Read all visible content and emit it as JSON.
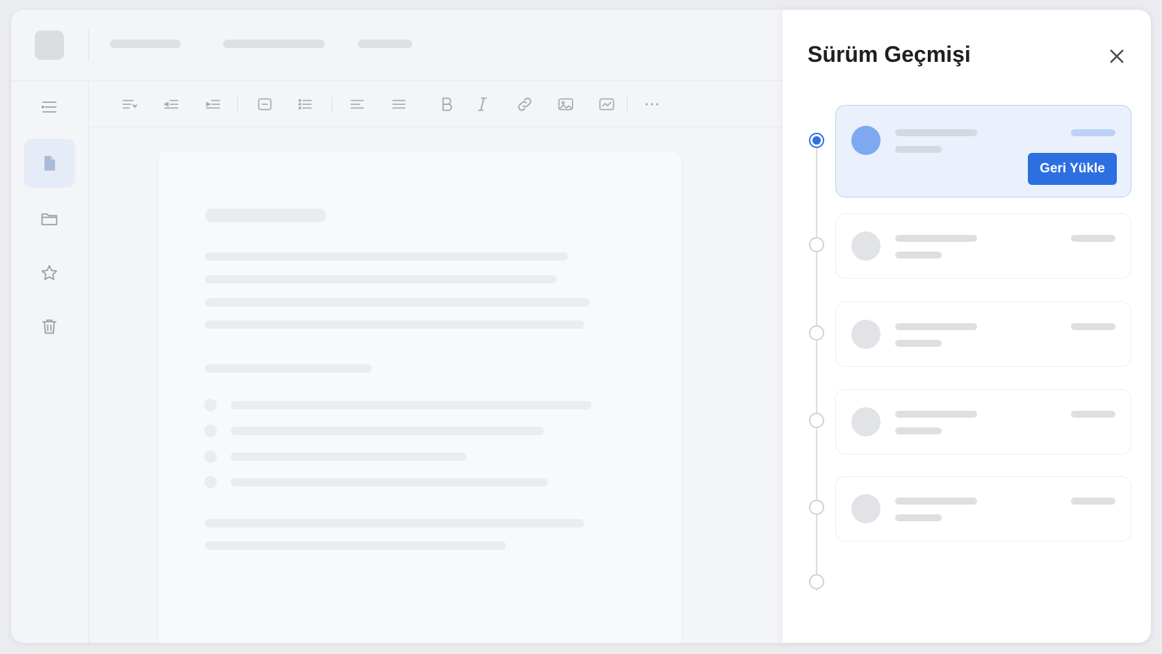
{
  "panel": {
    "title": "Sürüm Geçmişi",
    "close_icon": "close-icon",
    "restore_label": "Geri Yükle"
  },
  "colors": {
    "accent": "#2c6fe0",
    "selected_card_bg": "#eaf1fc",
    "selected_card_border": "#b9cff2"
  },
  "rail": {
    "items": [
      {
        "icon": "menu-icon",
        "active": false
      },
      {
        "icon": "document-icon",
        "active": true
      },
      {
        "icon": "folder-icon",
        "active": false
      },
      {
        "icon": "star-icon",
        "active": false
      },
      {
        "icon": "trash-icon",
        "active": false
      }
    ]
  },
  "toolbar": {
    "icons": [
      "align-left-dropdown-icon",
      "indent-decrease-icon",
      "indent-increase-icon",
      "text-box-icon",
      "bulleted-list-icon",
      "align-left-icon",
      "align-justify-icon",
      "bold-icon",
      "italic-icon",
      "link-icon",
      "image-icon",
      "image-edit-icon",
      "more-icon"
    ]
  },
  "versions": [
    {
      "selected": true
    },
    {
      "selected": false
    },
    {
      "selected": false
    },
    {
      "selected": false
    },
    {
      "selected": false
    }
  ]
}
